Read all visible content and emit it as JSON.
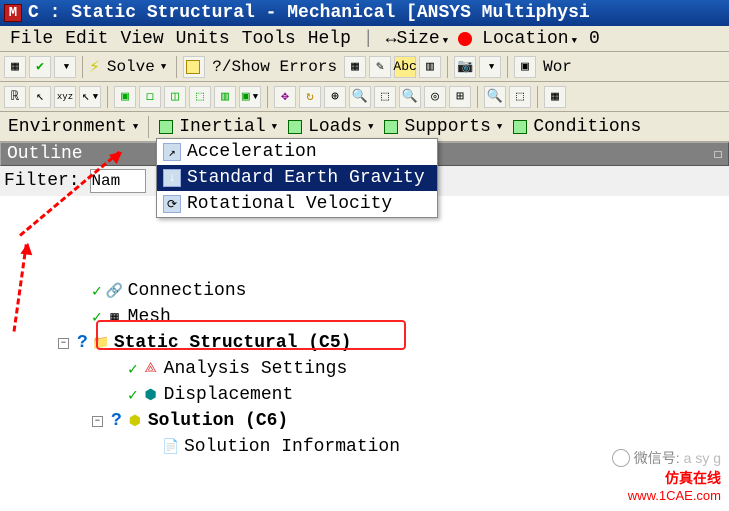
{
  "title": "C : Static Structural - Mechanical [ANSYS Multiphysi",
  "menubar": {
    "file": "File",
    "edit": "Edit",
    "view": "View",
    "units": "Units",
    "tools": "Tools",
    "help": "Help",
    "size": "↔Size",
    "location": "Location",
    "tail": "0"
  },
  "toolbar1": {
    "solve": "Solve",
    "show_errors": "?/Show Errors",
    "wor": "Wor"
  },
  "toolbar3": {
    "environment": "Environment",
    "inertial": "Inertial",
    "loads": "Loads",
    "supports": "Supports",
    "conditions": "Conditions"
  },
  "dropdown": {
    "items": [
      {
        "label": "Acceleration"
      },
      {
        "label": "Standard Earth Gravity"
      },
      {
        "label": "Rotational Velocity"
      }
    ]
  },
  "outline": {
    "header": "Outline",
    "filter_label": "Filter:",
    "filter_name": "Nam"
  },
  "tree": {
    "connections": "Connections",
    "mesh": "Mesh",
    "static_structural": "Static Structural (C5)",
    "analysis_settings": "Analysis Settings",
    "displacement": "Displacement",
    "solution": "Solution (C6)",
    "solution_info": "Solution Information"
  },
  "watermark": {
    "wechat_label": "微信号:",
    "wechat_id": "a sy g",
    "brand": "仿真在线",
    "url": "www.1CAE.com"
  }
}
